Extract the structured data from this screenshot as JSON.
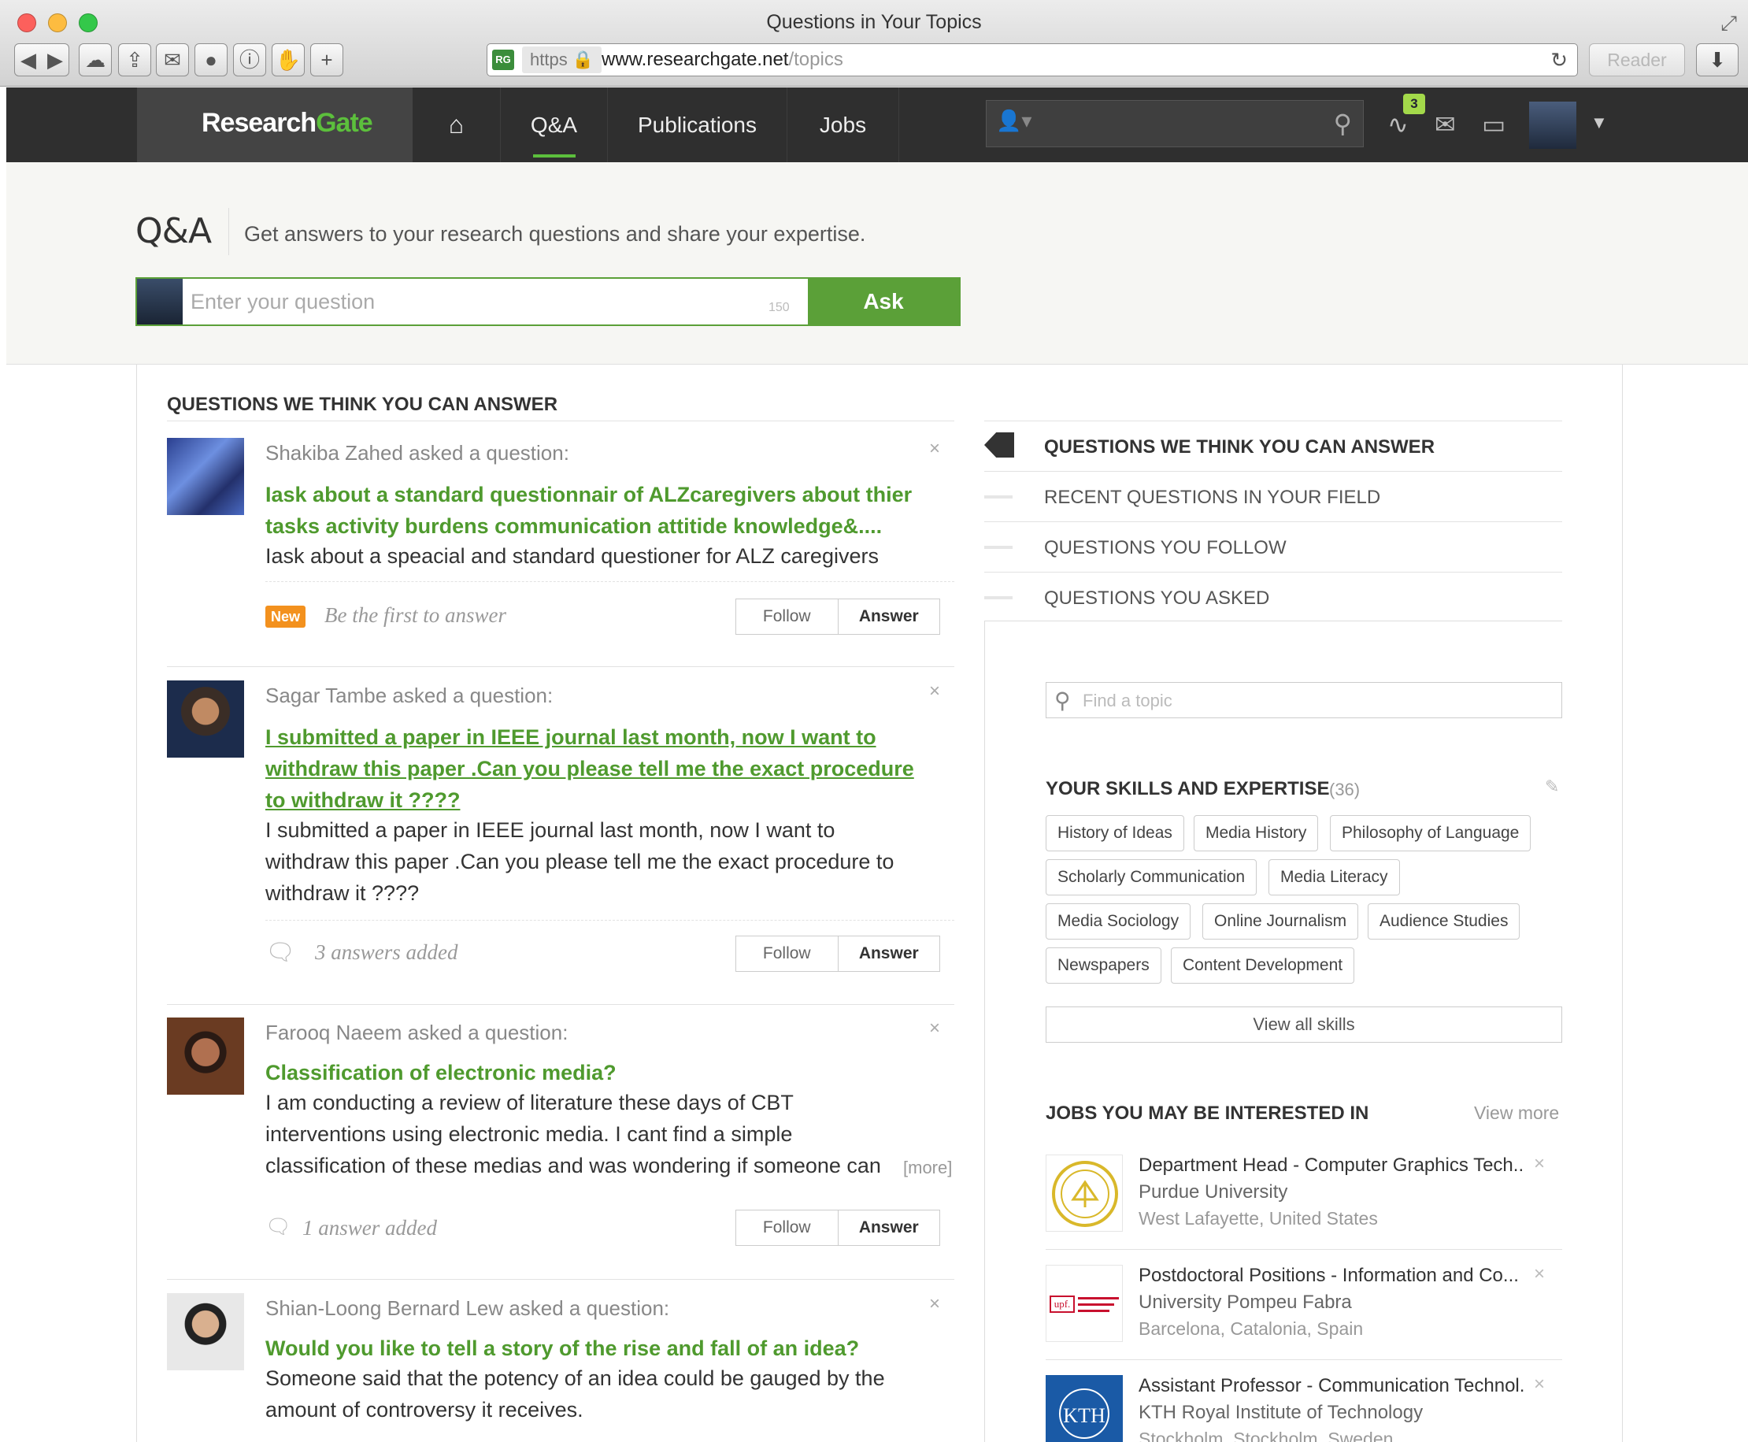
{
  "browser": {
    "window_title": "Questions in Your Topics",
    "https_label": "https",
    "url_host": "www.researchgate.net",
    "url_path": "/topics",
    "reader_label": "Reader",
    "favicon_text": "RG"
  },
  "nav": {
    "logo_research": "Research",
    "logo_gate": "Gate",
    "items": [
      "Q&A",
      "Publications",
      "Jobs"
    ],
    "notification_count": "3"
  },
  "qa_header": {
    "title": "Q&A",
    "tagline": "Get answers to your research questions and share your expertise.",
    "input_placeholder": "Enter your question",
    "char_limit": "150",
    "ask_label": "Ask"
  },
  "feed": {
    "heading": "QUESTIONS WE THINK YOU CAN ANSWER",
    "follow_label": "Follow",
    "answer_label": "Answer",
    "more_label": "[more]",
    "questions": [
      {
        "asker": "Shakiba Zahed asked a question:",
        "title_lines": [
          "Iask about a standard questionnair of ALZcaregivers about thier",
          "tasks activity burdens communication attitide knowledge&...."
        ],
        "body_lines": [
          "Iask about a speacial and standard questioner for ALZ caregivers"
        ],
        "badge": "New",
        "status": "Be the first to answer"
      },
      {
        "asker": "Sagar Tambe asked a question:",
        "title_lines": [
          "I submitted a paper in IEEE journal last month, now I want to",
          "withdraw this paper .Can you please tell me the exact procedure",
          "to withdraw it ????"
        ],
        "body_lines": [
          "I submitted a paper in IEEE journal last month, now I want to",
          "withdraw this paper .Can you please tell me the exact procedure to",
          "withdraw it ????"
        ],
        "status": "3 answers added"
      },
      {
        "asker": "Farooq Naeem asked a question:",
        "title_lines": [
          "Classification of electronic media?"
        ],
        "body_lines": [
          "I am conducting a review of literature these days of CBT",
          "interventions using electronic media. I cant find a simple",
          "classification of these medias and was wondering if someone can"
        ],
        "status": "1 answer added"
      },
      {
        "asker": "Shian-Loong Bernard Lew asked a question:",
        "title_lines": [
          "Would you like to tell a story of the rise and fall of an idea?"
        ],
        "body_lines": [
          "Someone said that the potency of an idea could be gauged by the",
          "amount of controversy it receives."
        ]
      }
    ]
  },
  "sidebar": {
    "nav_items": [
      "QUESTIONS WE THINK YOU CAN ANSWER",
      "RECENT QUESTIONS IN YOUR FIELD",
      "QUESTIONS YOU FOLLOW",
      "QUESTIONS YOU ASKED"
    ],
    "topic_placeholder": "Find a topic",
    "skills_heading": "YOUR SKILLS AND EXPERTISE",
    "skills_count": "(36)",
    "skills": [
      "History of Ideas",
      "Media History",
      "Philosophy of Language",
      "Scholarly Communication",
      "Media Literacy",
      "Media Sociology",
      "Online Journalism",
      "Audience Studies",
      "Newspapers",
      "Content Development"
    ],
    "view_all_label": "View all skills",
    "jobs_heading": "JOBS YOU MAY BE INTERESTED IN",
    "view_more_label": "View more",
    "jobs": [
      {
        "title": "Department Head - Computer Graphics Tech...",
        "org": "Purdue University",
        "location": "West Lafayette, United States"
      },
      {
        "title": "Postdoctoral Positions - Information and Co...",
        "org": "University Pompeu Fabra",
        "location": "Barcelona, Catalonia, Spain"
      },
      {
        "title": "Assistant Professor - Communication Technol...",
        "org": "KTH Royal Institute of Technology",
        "location": "Stockholm, Stockholm, Sweden"
      }
    ],
    "job_logo_texts": [
      "upf.",
      "KTH"
    ]
  },
  "colors": {
    "accent_green": "#5ba038",
    "link_green": "#4f9a2e",
    "nav_dark": "#2f2f2f",
    "badge_orange": "#f3911e"
  }
}
